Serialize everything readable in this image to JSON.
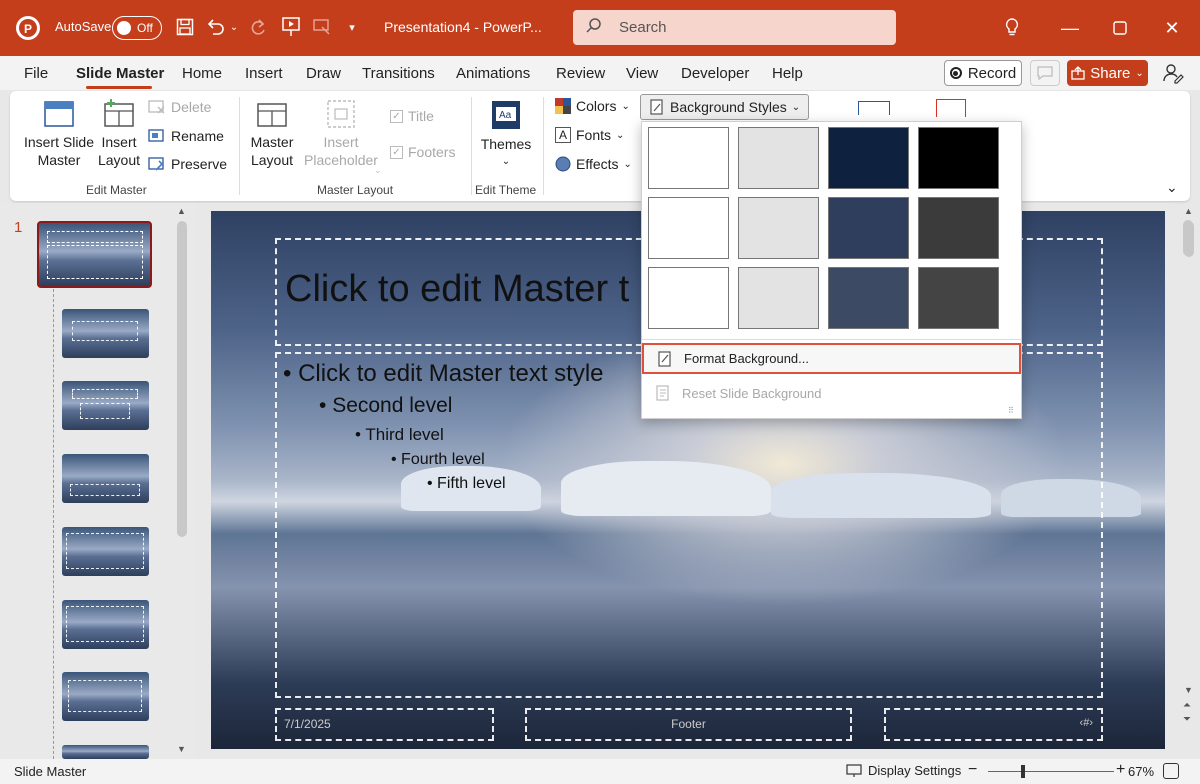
{
  "titlebar": {
    "autosave_label": "AutoSave",
    "autosave_state": "Off",
    "doc_title": "Presentation4  -  PowerP...",
    "search_placeholder": "Search"
  },
  "tabs": [
    "File",
    "Slide Master",
    "Home",
    "Insert",
    "Draw",
    "Transitions",
    "Animations",
    "Review",
    "View",
    "Developer",
    "Help"
  ],
  "actions": {
    "record": "Record",
    "share": "Share"
  },
  "ribbon": {
    "edit_master": {
      "insert_slide_master": [
        "Insert Slide",
        "Master"
      ],
      "insert_layout": [
        "Insert",
        "Layout"
      ],
      "delete": "Delete",
      "rename": "Rename",
      "preserve": "Preserve",
      "group_label": "Edit Master"
    },
    "master_layout": {
      "master_layout": [
        "Master",
        "Layout"
      ],
      "insert_placeholder": [
        "Insert",
        "Placeholder"
      ],
      "title": "Title",
      "footers": "Footers",
      "group_label": "Master Layout"
    },
    "edit_theme": {
      "themes": "Themes",
      "group_label": "Edit Theme"
    },
    "background": {
      "colors": "Colors",
      "fonts": "Fonts",
      "effects": "Effects",
      "bg_styles": "Background Styles"
    }
  },
  "dropdown": {
    "swatches": [
      "#ffffff",
      "#e3e3e3",
      "#0e2240",
      "#000000",
      "#ffffff",
      "#e3e3e3",
      "#2f3e5c",
      "#3b3b3b",
      "#ffffff",
      "#e3e3e3",
      "#3d4a63",
      "#444444"
    ],
    "format_background": "Format Background...",
    "reset_background": "Reset Slide Background"
  },
  "thumbnails": {
    "first_number": "1"
  },
  "slide": {
    "title": "Click to edit Master t",
    "level1": "Click to edit Master text style",
    "level2": "Second level",
    "level3": "Third level",
    "level4": "Fourth level",
    "level5": "Fifth level",
    "date": "7/1/2025",
    "footer": "Footer",
    "page_number": "‹#›"
  },
  "statusbar": {
    "view_name": "Slide Master",
    "display_settings": "Display Settings",
    "zoom": "67%"
  },
  "colors": {
    "accent": "#c43e1c",
    "highlight_border": "#e0513b",
    "thumb_selected": "#8b1a1a"
  }
}
